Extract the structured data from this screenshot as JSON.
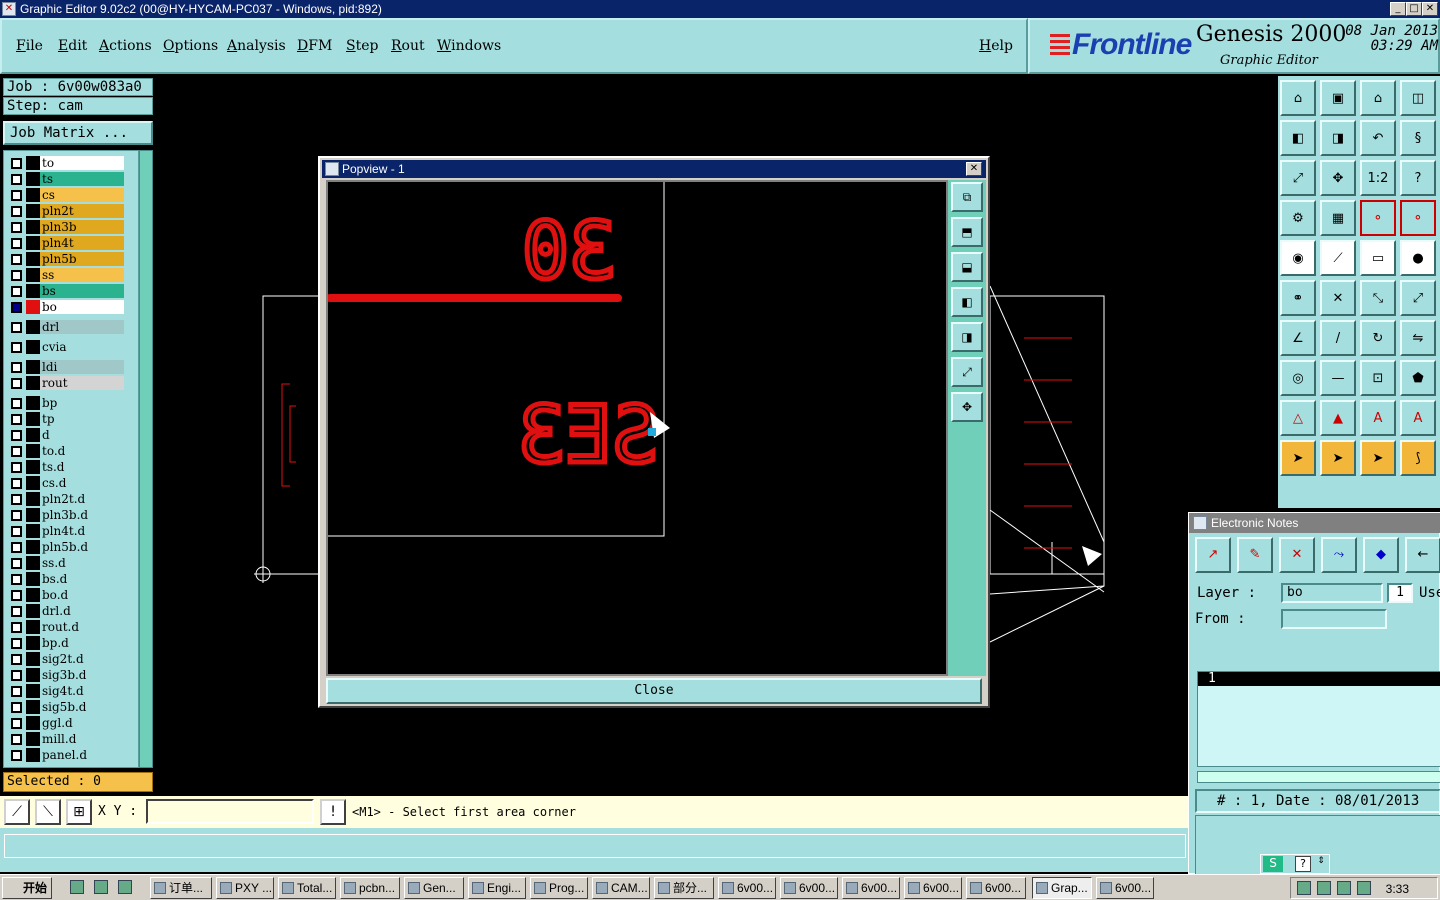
{
  "window": {
    "title": "Graphic Editor 9.02c2 (00@HY-HYCAM-PC037 - Windows, pid:892)"
  },
  "menu": [
    "File",
    "Edit",
    "Actions",
    "Options",
    "Analysis",
    "DFM",
    "Step",
    "Rout",
    "Windows"
  ],
  "help": "Help",
  "logo": {
    "brand": "Frontline",
    "product": "Genesis 2000",
    "subtitle": "Graphic Editor",
    "date": "08 Jan 2013",
    "time": "03:29 AM"
  },
  "job": {
    "label": "Job  :  6v00w083a0",
    "step": "Step:  cam",
    "matrix_button": "Job Matrix ..."
  },
  "layers": [
    {
      "name": "to",
      "color": "#ffffff"
    },
    {
      "name": "ts",
      "color": "#2bb38f"
    },
    {
      "name": "cs",
      "color": "#f5c14a"
    },
    {
      "name": "pln2t",
      "color": "#e0a81e"
    },
    {
      "name": "pln3b",
      "color": "#e0a81e"
    },
    {
      "name": "pln4t",
      "color": "#e0a81e"
    },
    {
      "name": "pln5b",
      "color": "#e0a81e"
    },
    {
      "name": "ss",
      "color": "#f5c14a"
    },
    {
      "name": "bs",
      "color": "#2bb38f"
    },
    {
      "name": "bo",
      "color": "#ffffff"
    },
    {
      "name": "drl",
      "color": "#a0c8c8"
    },
    {
      "name": "cvia",
      "color": "#a5dede"
    },
    {
      "name": "ldi",
      "color": "#a0c8c8"
    },
    {
      "name": "rout",
      "color": "#d4d4d4"
    },
    {
      "name": "bp",
      "color": "#a5dede"
    },
    {
      "name": "tp",
      "color": "#a5dede"
    },
    {
      "name": "d",
      "color": "#a5dede"
    },
    {
      "name": "to.d",
      "color": "#a5dede"
    },
    {
      "name": "ts.d",
      "color": "#a5dede"
    },
    {
      "name": "cs.d",
      "color": "#a5dede"
    },
    {
      "name": "pln2t.d",
      "color": "#a5dede"
    },
    {
      "name": "pln3b.d",
      "color": "#a5dede"
    },
    {
      "name": "pln4t.d",
      "color": "#a5dede"
    },
    {
      "name": "pln5b.d",
      "color": "#a5dede"
    },
    {
      "name": "ss.d",
      "color": "#a5dede"
    },
    {
      "name": "bs.d",
      "color": "#a5dede"
    },
    {
      "name": "bo.d",
      "color": "#a5dede"
    },
    {
      "name": "drl.d",
      "color": "#a5dede"
    },
    {
      "name": "rout.d",
      "color": "#a5dede"
    },
    {
      "name": "bp.d",
      "color": "#a5dede"
    },
    {
      "name": "sig2t.d",
      "color": "#a5dede"
    },
    {
      "name": "sig3b.d",
      "color": "#a5dede"
    },
    {
      "name": "sig4t.d",
      "color": "#a5dede"
    },
    {
      "name": "sig5b.d",
      "color": "#a5dede"
    },
    {
      "name": "ggl.d",
      "color": "#a5dede"
    },
    {
      "name": "mill.d",
      "color": "#a5dede"
    },
    {
      "name": "panel.d",
      "color": "#a5dede"
    }
  ],
  "selected": "Selected : 0",
  "status": {
    "xy_label": "X Y :",
    "prompt": "<M1> - Select first area corner"
  },
  "popview": {
    "title": "Popview - 1",
    "close": "Close",
    "text_top": "30",
    "text_bottom": "SE3"
  },
  "enotes": {
    "title": "Electronic Notes",
    "layer_label": "Layer  :",
    "layer_value": "bo",
    "layer_num": "1",
    "use_label": "Use",
    "from_label": "From   :",
    "list_header": "1",
    "status_line": "# : 1, Date : 08/01/2013"
  },
  "taskbar": {
    "start": "开始",
    "items": [
      "订单...",
      "PXY ...",
      "Total...",
      "pcbn...",
      "Gen...",
      "Engi...",
      "Prog...",
      "CAM...",
      "部分...",
      "6v00...",
      "6v00...",
      "6v00...",
      "6v00...",
      "6v00...",
      "Grap...",
      "6v00..."
    ],
    "clock": "3:33"
  },
  "colors": {
    "panel": "#a5dede",
    "accent_red": "#e01010",
    "title_blue": "#0a246a"
  }
}
